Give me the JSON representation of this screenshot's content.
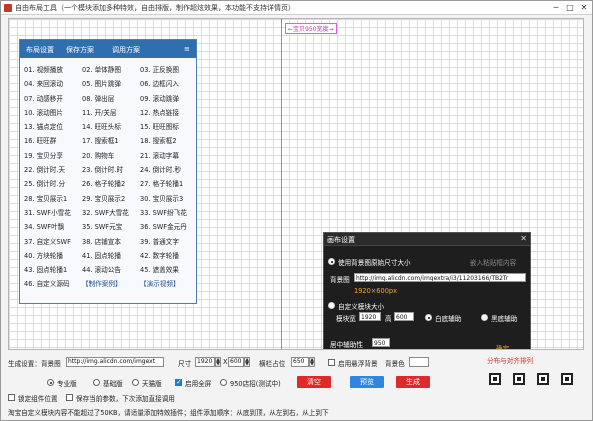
{
  "window": {
    "title": "自由布局工具（一个模块添加多种特效，自由排版，制作超炫效果，本功能不支持详情页）",
    "minimize": "─",
    "maximize": "□",
    "close": "✕"
  },
  "canvas": {
    "guide_label": "←宝贝950宽度→"
  },
  "panel": {
    "tabs": [
      "布局设置",
      "保存方案",
      "调用方案"
    ],
    "menu_icon": "≡",
    "items": [
      [
        "01. 视频播放",
        "02. 单体静图",
        "03. 正反换图"
      ],
      [
        "04. 来回滚动",
        "05. 图片跳弹",
        "06. 边框闪入"
      ],
      [
        "07. 动感移开",
        "08. 弹出层",
        "09. 滚动跳弹"
      ],
      [
        "10. 滚动图片",
        "11. 开/关层",
        "12. 热点链接"
      ],
      [
        "13. 锚点定位",
        "14. 旺旺头标",
        "15. 旺旺图标"
      ],
      [
        "16. 旺旺群",
        "17. 搜索框1",
        "18. 搜索框2"
      ],
      [
        "19. 宝贝分享",
        "20. 购物车",
        "21. 滚动字幕"
      ],
      [
        "22. 倒计时.天",
        "23. 倒计时.时",
        "24. 倒计时.秒"
      ],
      [
        "25. 倒计时.分",
        "26. 格子轮播2",
        "27. 格子轮播1"
      ],
      [
        "28. 宝贝展示1",
        "29. 宝贝展示2",
        "30. 宝贝展示3"
      ],
      [
        "31. SWF小雪花",
        "32. SWF大雪花",
        "33. SWF纷飞花"
      ],
      [
        "34. SWF叶飘",
        "35. SWF元宝",
        "36. SWF金元丹"
      ],
      [
        "37. 自定义SWF",
        "38. 店铺宣本",
        "39. 普通文字"
      ],
      [
        "40. 方块轮播",
        "41. 固点轮播",
        "42. 数字轮播"
      ],
      [
        "43. 固点轮播1",
        "44. 滚动公告",
        "45. 遮盖效果"
      ],
      [
        "46. 自定义源码",
        "【制作案例】",
        "【演示视频】"
      ]
    ]
  },
  "dialog": {
    "title": "画布设置",
    "close": "✕",
    "opt_bg_size": "使用背景图原始尺寸大小",
    "hint_paste": "嵌入粘贴框内容",
    "bg_label": "背景图",
    "bg_url": "http://img.alicdn.com/imgextra/i3/11203166/TB2Tr",
    "bg_size_text": "1920×600px",
    "opt_custom": "自定义模块大小",
    "width_label": "模块宽",
    "width_value": "1920",
    "height_label": "高",
    "height_value": "600",
    "opt_white": "白底辅助",
    "opt_black": "黑底辅助",
    "center_label": "居中辅助性",
    "center_value": "950",
    "confirm": "确定"
  },
  "bottom": {
    "gen_label": "生成设置：背景图",
    "bg_url": "http://img.alicdn.com/imgext",
    "size_label": "尺寸",
    "size_w": "1920",
    "size_x": "X",
    "size_h": "600",
    "seal_label": "横栏占位",
    "seal_value": "650",
    "float_bg_label": "启用悬浮背景",
    "bg_color_label": "背景色",
    "layout_hint": "分布与对齐排列",
    "version_pro": "专业版",
    "version_basic": "基础版",
    "version_tmall": "天猫版",
    "fullscreen": "启用全屏",
    "full_950": "950店招(测试中)",
    "btn_clear": "清空",
    "btn_preview": "预览",
    "btn_generate": "生成",
    "lock_label": "锁定组件位置",
    "save_label": "保存当前参数，下次添加直接调用",
    "status": "淘宝自定义模块内容不能超过了50KB，请适量添加特效插件；组件添加顺序：从底到顶，从左到右，从上到下"
  },
  "colors": {
    "panel_head": "#2f6fb0",
    "accent_red": "#e02a2a",
    "accent_blue": "#2e86de",
    "guide": "#e05cd5",
    "dialog_bg": "#1e1e1e"
  }
}
